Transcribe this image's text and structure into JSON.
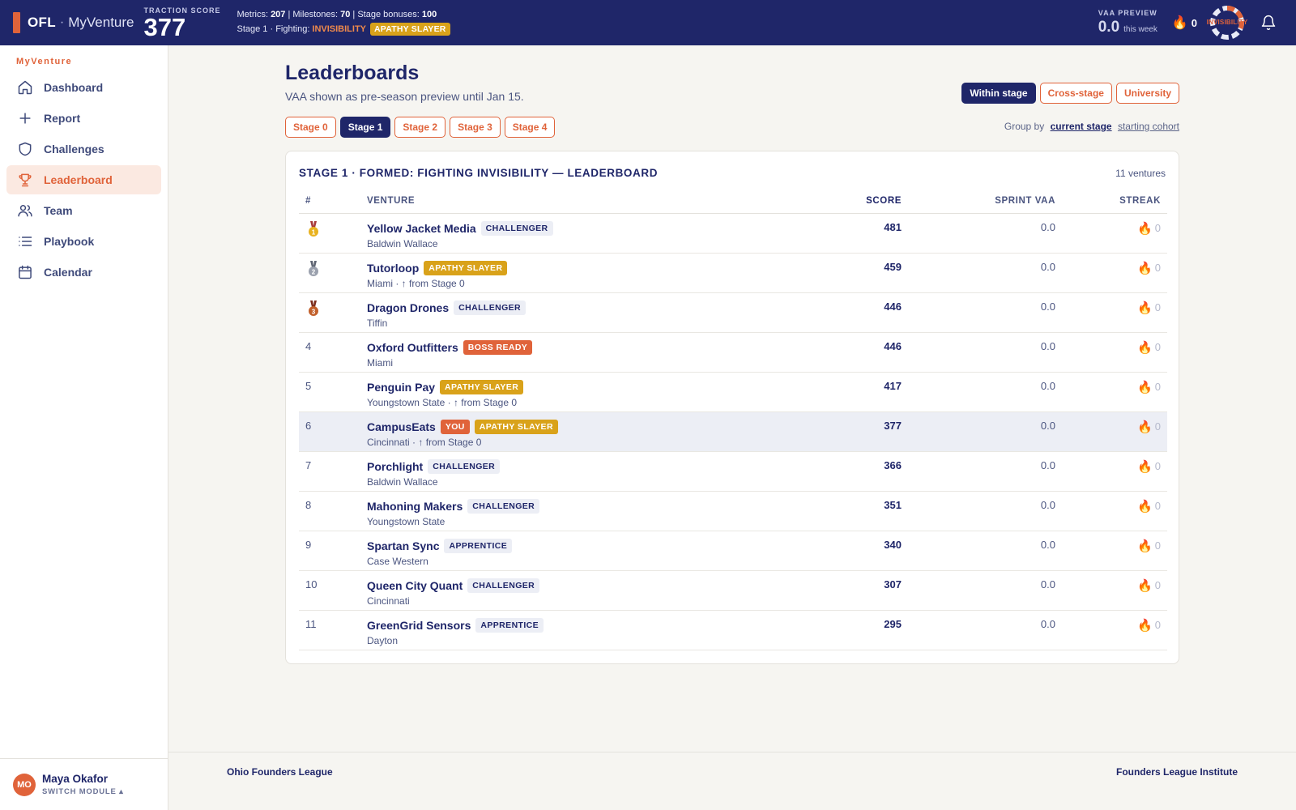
{
  "topbar": {
    "brand": "OFL",
    "brand_sep": "·",
    "module": "MyVenture",
    "traction_label": "TRACTION SCORE",
    "traction_value": "377",
    "metrics_label": "Metrics:",
    "metrics_value": "207",
    "milestones_label": "| Milestones:",
    "milestones_value": "70",
    "bonuses_label": "| Stage bonuses:",
    "bonuses_value": "100",
    "stage_line": "Stage 1 · Fighting:",
    "fighting": "INVISIBILITY",
    "badge": "APATHY SLAYER",
    "vaa_label": "VAA PREVIEW",
    "vaa_value": "0.0",
    "vaa_sub": "this week",
    "streak": "0",
    "boss_ring_label": "INVISIBILITY",
    "icons": {
      "streak": "flame-icon",
      "notifications": "bell-icon"
    }
  },
  "sidebar": {
    "title": "MyVenture",
    "items": [
      {
        "label": "Dashboard",
        "icon": "home-icon"
      },
      {
        "label": "Report",
        "icon": "plus-icon"
      },
      {
        "label": "Challenges",
        "icon": "shield-icon"
      },
      {
        "label": "Leaderboard",
        "icon": "trophy-icon",
        "active": true
      },
      {
        "label": "Team",
        "icon": "users-icon"
      },
      {
        "label": "Playbook",
        "icon": "list-icon"
      },
      {
        "label": "Calendar",
        "icon": "calendar-icon"
      }
    ],
    "user": {
      "initials": "MO",
      "name": "Maya Okafor",
      "switch": "SWITCH MODULE ▴"
    }
  },
  "page": {
    "title": "Leaderboards",
    "subtitle": "VAA shown as pre-season preview until Jan 15.",
    "views": [
      "Within stage",
      "Cross-stage",
      "University"
    ],
    "stage_tabs": [
      "Stage 0",
      "Stage 1",
      "Stage 2",
      "Stage 3",
      "Stage 4"
    ],
    "group_by": {
      "label": "Group by",
      "options": [
        "current stage",
        "starting cohort"
      ]
    }
  },
  "leaderboard": {
    "title": "STAGE 1 · FORMED: FIGHTING INVISIBILITY — LEADERBOARD",
    "count": "11 ventures",
    "columns": [
      "#",
      "VENTURE",
      "SCORE",
      "SPRINT VAA",
      "STREAK"
    ],
    "rows": [
      {
        "rank": "1",
        "medal": "gold",
        "name": "Yellow Jacket Media",
        "tags": [
          {
            "text": "CHALLENGER",
            "kind": "challenger"
          }
        ],
        "sub": "Baldwin Wallace",
        "score": "481",
        "vaa": "0.0",
        "streak": "0"
      },
      {
        "rank": "2",
        "medal": "silver",
        "name": "Tutorloop",
        "tags": [
          {
            "text": "APATHY SLAYER",
            "kind": "apathy"
          }
        ],
        "sub": "Miami · ↑ from Stage 0",
        "score": "459",
        "vaa": "0.0",
        "streak": "0"
      },
      {
        "rank": "3",
        "medal": "bronze",
        "name": "Dragon Drones",
        "tags": [
          {
            "text": "CHALLENGER",
            "kind": "challenger"
          }
        ],
        "sub": "Tiffin",
        "score": "446",
        "vaa": "0.0",
        "streak": "0"
      },
      {
        "rank": "4",
        "name": "Oxford Outfitters",
        "tags": [
          {
            "text": "BOSS READY",
            "kind": "boss"
          }
        ],
        "sub": "Miami",
        "score": "446",
        "vaa": "0.0",
        "streak": "0"
      },
      {
        "rank": "5",
        "name": "Penguin Pay",
        "tags": [
          {
            "text": "APATHY SLAYER",
            "kind": "apathy"
          }
        ],
        "sub": "Youngstown State · ↑ from Stage 0",
        "score": "417",
        "vaa": "0.0",
        "streak": "0"
      },
      {
        "rank": "6",
        "name": "CampusEats",
        "you": true,
        "tags": [
          {
            "text": "YOU",
            "kind": "you"
          },
          {
            "text": "APATHY SLAYER",
            "kind": "apathy"
          }
        ],
        "sub": "Cincinnati · ↑ from Stage 0",
        "score": "377",
        "vaa": "0.0",
        "streak": "0"
      },
      {
        "rank": "7",
        "name": "Porchlight",
        "tags": [
          {
            "text": "CHALLENGER",
            "kind": "challenger"
          }
        ],
        "sub": "Baldwin Wallace",
        "score": "366",
        "vaa": "0.0",
        "streak": "0"
      },
      {
        "rank": "8",
        "name": "Mahoning Makers",
        "tags": [
          {
            "text": "CHALLENGER",
            "kind": "challenger"
          }
        ],
        "sub": "Youngstown State",
        "score": "351",
        "vaa": "0.0",
        "streak": "0"
      },
      {
        "rank": "9",
        "name": "Spartan Sync",
        "tags": [
          {
            "text": "APPRENTICE",
            "kind": "apprentice"
          }
        ],
        "sub": "Case Western",
        "score": "340",
        "vaa": "0.0",
        "streak": "0"
      },
      {
        "rank": "10",
        "name": "Queen City Quant",
        "tags": [
          {
            "text": "CHALLENGER",
            "kind": "challenger"
          }
        ],
        "sub": "Cincinnati",
        "score": "307",
        "vaa": "0.0",
        "streak": "0"
      },
      {
        "rank": "11",
        "name": "GreenGrid Sensors",
        "tags": [
          {
            "text": "APPRENTICE",
            "kind": "apprentice"
          }
        ],
        "sub": "Dayton",
        "score": "295",
        "vaa": "0.0",
        "streak": "0"
      }
    ]
  },
  "footer": {
    "left": "Ohio Founders League",
    "right": "Founders League Institute"
  },
  "colors": {
    "navy": "#1f2669",
    "accent": "#e0633a",
    "gold": "#d9a21a",
    "you_row": "#eceef5"
  }
}
